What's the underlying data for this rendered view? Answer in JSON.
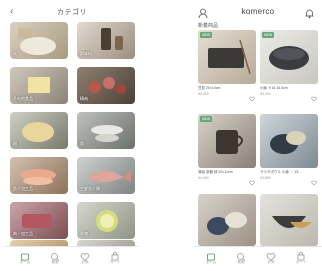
{
  "left_screen": {
    "title": "カテゴリ",
    "categories": [
      {
        "label": "米"
      },
      {
        "label": "調味料"
      },
      {
        "label": "その他食品"
      },
      {
        "label": "精肉"
      },
      {
        "label": "麺"
      },
      {
        "label": "魚"
      },
      {
        "label": "魚介加工品"
      },
      {
        "label": "生鮮魚介類"
      },
      {
        "label": "肉・加工品"
      },
      {
        "label": "果物"
      },
      {
        "label": ""
      },
      {
        "label": ""
      }
    ]
  },
  "right_screen": {
    "brand": "komerco",
    "section_title": "新着商品",
    "products": [
      {
        "badge": "NEW",
        "name": "豆皿 25×10cm",
        "price": "¥4,400"
      },
      {
        "badge": "NEW",
        "name": "小鉢 ￥16 16.5cm",
        "price": "¥3,300"
      },
      {
        "badge": "NEW",
        "name": "湯呑 茶器 鉢 20×11cm",
        "price": "¥4,400"
      },
      {
        "badge": "",
        "name": "サラダボウル 小鉢 ・ 15...",
        "price": "¥3,850"
      },
      {
        "badge": "",
        "name": "",
        "price": ""
      },
      {
        "badge": "",
        "name": "",
        "price": ""
      }
    ]
  },
  "tabbar": {
    "tabs": [
      {
        "label": "ホーム"
      },
      {
        "label": "検索"
      },
      {
        "label": "お気"
      },
      {
        "label": "カート"
      }
    ]
  },
  "colors": {
    "accent": "#6aa679",
    "tab_active": "#5c8a6a"
  }
}
